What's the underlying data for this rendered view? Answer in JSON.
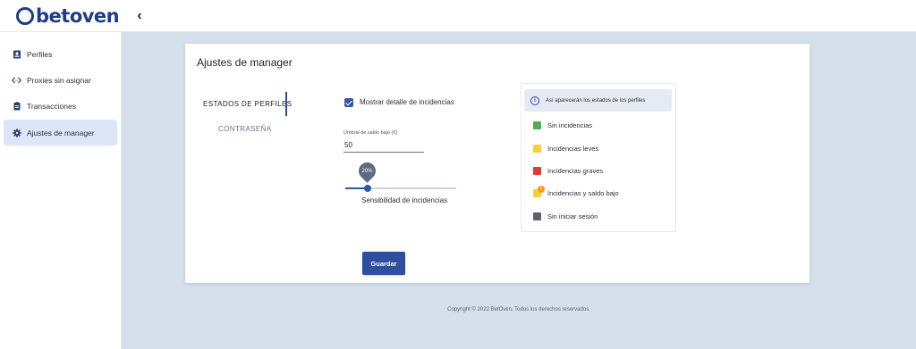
{
  "brand": {
    "name": "betoven",
    "color": "#1f3d85"
  },
  "topbar": {
    "collapse_icon": "chevron-left-icon",
    "collapse_glyph": "‹"
  },
  "sidebar": {
    "items": [
      {
        "label": "Perfiles",
        "icon": "id-card-icon",
        "active": false
      },
      {
        "label": "Proxies sin asignar",
        "icon": "code-arrows-icon",
        "active": false
      },
      {
        "label": "Transacciones",
        "icon": "clipboard-icon",
        "active": false
      },
      {
        "label": "Ajustes de manager",
        "icon": "gear-icon",
        "active": true
      }
    ]
  },
  "card": {
    "title": "Ajustes de manager",
    "tabs": [
      {
        "label": "ESTADOS DE PERFILES",
        "active": true
      },
      {
        "label": "CONTRASEÑA",
        "active": false
      }
    ],
    "show_details": {
      "label": "Mostrar detalle de incidencias",
      "checked": true
    },
    "threshold": {
      "label": "Umbral de saldo bajo (€)",
      "value": "50"
    },
    "sensitivity": {
      "label": "Sensibilidad de incidencias",
      "value_text": "20%",
      "value": 0.2
    },
    "save_label": "Guardar"
  },
  "legend": {
    "header": "Así aparecerán los estados de los perfiles",
    "info_glyph": "i",
    "items": [
      {
        "label": "Sin incidencias",
        "color": "#4caf50"
      },
      {
        "label": "Incidencias leves",
        "color": "#f5d033"
      },
      {
        "label": "Incidencias graves",
        "color": "#e53935"
      },
      {
        "label": "Incidencias y saldo bajo",
        "color": "#f5d033",
        "badge": "!"
      },
      {
        "label": "Sin iniciar sesión",
        "color": "#5f6368"
      }
    ]
  },
  "colors": {
    "accent": "#2d4f9e",
    "background": "#d5dfec"
  },
  "footer": {
    "text": "Copyright © 2022 BetOven. Todos los derechos reservados."
  }
}
